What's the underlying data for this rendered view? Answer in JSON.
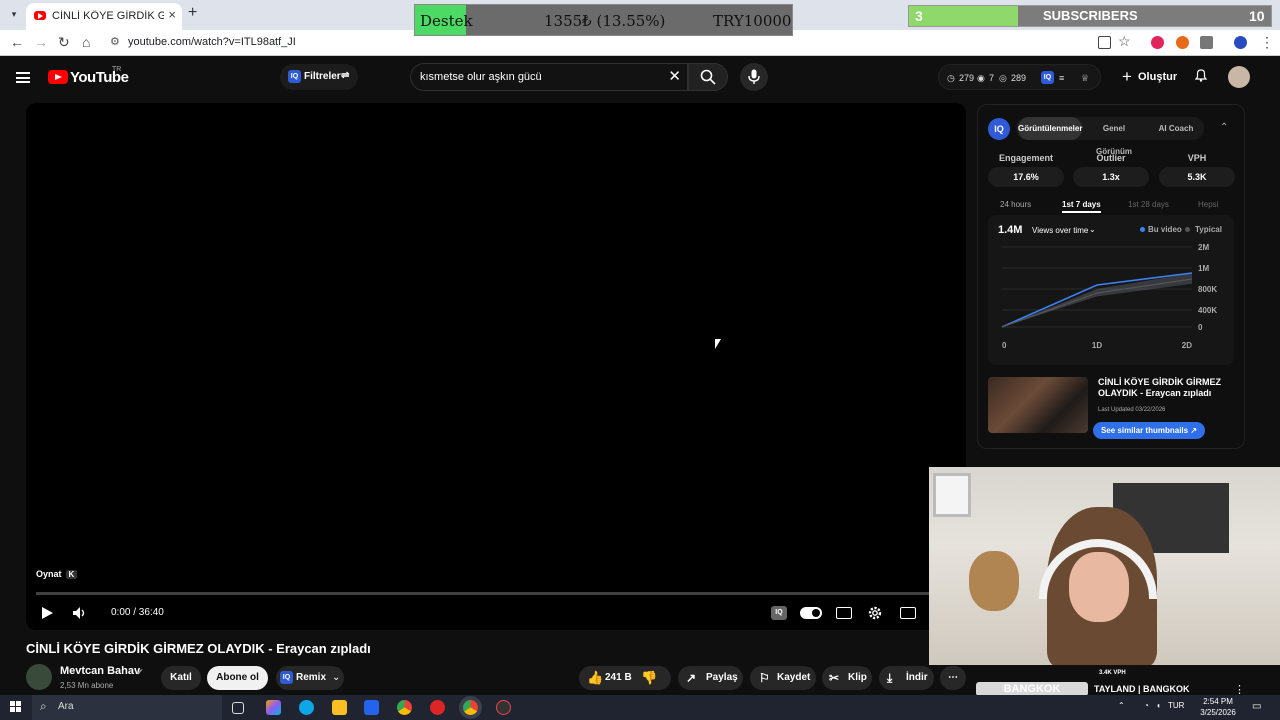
{
  "browser": {
    "tab_title": "CİNLİ KÖYE GİRDİK GİRMEZ OLAYDIK - Eraycan zıpladı - YouTube",
    "url": "youtube.com/watch?v=ITL98atf_JI",
    "window_controls": [
      "–",
      "▢",
      "✕"
    ]
  },
  "overlays": {
    "donate": {
      "label": "Destek",
      "amount": "1355₺ (13.55%)",
      "goal": "TRY10000",
      "progress": 0.1355
    },
    "subscribers": {
      "current": "3",
      "label": "SUBSCRIBERS",
      "goal": "10",
      "progress": 0.3
    }
  },
  "youtube": {
    "logo_text": "YouTube",
    "country": "TR",
    "filters_label": "Filtreler",
    "search_value": "kısmetse olur aşkın gücü",
    "stats": {
      "a": "279",
      "b": "7",
      "c": "289"
    },
    "create_label": "Oluştur"
  },
  "player": {
    "tooltip": "Oynat",
    "tooltip_key": "K",
    "time": "0:00 / 36:40"
  },
  "video": {
    "title": "CİNLİ KÖYE GİRDİK GİRMEZ OLAYDIK - Eraycan zıpladı",
    "channel": "Mevtcan Bahav",
    "subs": "2,53 Mn abone",
    "join": "Katıl",
    "subscribe": "Abone ol",
    "remix": "Remix",
    "likes": "241 B",
    "share": "Paylaş",
    "save": "Kaydet",
    "clip": "Klip",
    "download": "İndir"
  },
  "iq": {
    "tabs": [
      "Görüntülenmeler",
      "Genel Görünüm",
      "AI Coach"
    ],
    "metrics": [
      {
        "label": "Engagement",
        "value": "17.6%"
      },
      {
        "label": "Outlier",
        "value": "1.3x"
      },
      {
        "label": "VPH",
        "value": "5.3K"
      }
    ],
    "ranges": [
      "24 hours",
      "1st 7 days",
      "1st 28 days",
      "Hepsi"
    ],
    "views_total": "1.4M",
    "views_dropdown": "Views over time",
    "legend_this": "Bu video",
    "legend_typical": "Typical",
    "thumb_title": "CİNLİ KÖYE GİRDİK GİRMEZ OLAYDIK - Eraycan zıpladı",
    "last_updated": "Last Updated 03/22/2026",
    "similar_btn": "See similar thumbnails"
  },
  "chart_data": {
    "type": "line",
    "x": [
      "0",
      "1D",
      "2D"
    ],
    "yticks": [
      "2M",
      "1M",
      "800K",
      "400K",
      "0"
    ],
    "series": [
      {
        "name": "Bu video",
        "values": [
          0,
          1.05,
          1.35
        ],
        "color": "#3b82f6"
      },
      {
        "name": "Typical",
        "values": [
          0,
          0.85,
          1.2
        ],
        "color": "#555555"
      }
    ],
    "ylim": [
      0,
      2
    ]
  },
  "stream": {
    "bangkok": "BANGKOK",
    "tayland": "TAYLAND | BANGKOK",
    "vph": "3.4K VPH"
  },
  "taskbar": {
    "search": "Ara",
    "lang": "TUR",
    "time": "2:54 PM",
    "date": "3/25/2026"
  }
}
